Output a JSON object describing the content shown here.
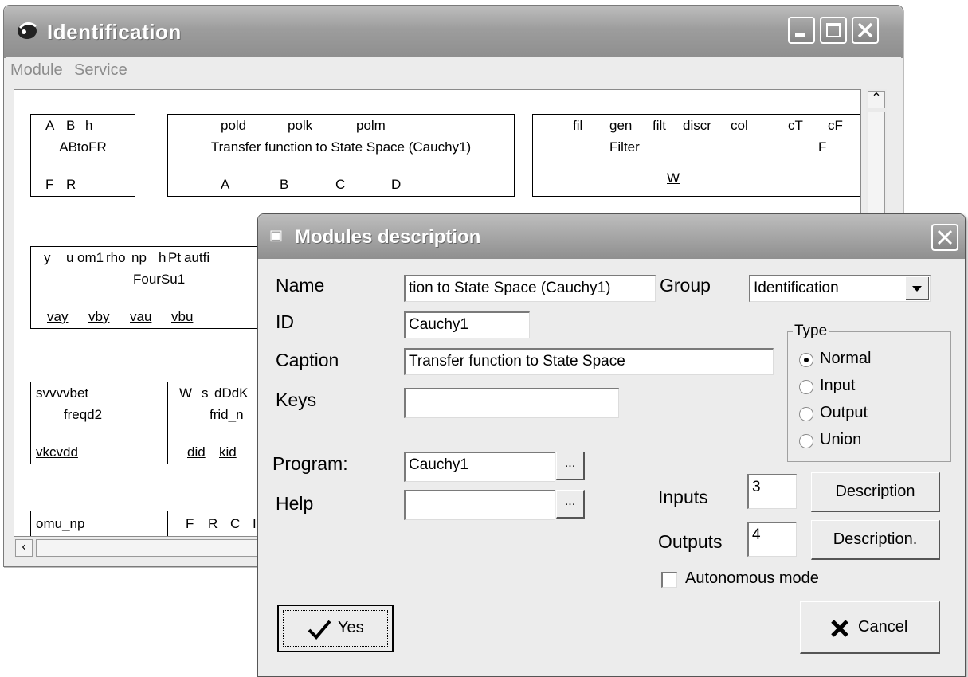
{
  "main_window": {
    "title": "Identification",
    "menu": [
      "Module",
      "Service"
    ]
  },
  "modules": [
    {
      "id": "abtofr",
      "inputs": [
        "A",
        "B",
        "h"
      ],
      "name": "ABtoFR",
      "outputs": [
        "F",
        "R"
      ]
    },
    {
      "id": "tf2ss",
      "inputs": [
        "pold",
        "polk",
        "polm"
      ],
      "name": "Transfer function to State Space  (Cauchy1)",
      "outputs": [
        "A",
        "B",
        "C",
        "D"
      ]
    },
    {
      "id": "filter",
      "inputs": [
        "fil",
        "gen",
        "filt",
        "discr",
        "col",
        "cT",
        "cF"
      ],
      "name": "Filter",
      "name2": "F",
      "outputs": [
        "W"
      ]
    },
    {
      "id": "foursu1",
      "inputs": [
        "y",
        "u",
        "om1",
        "rho",
        "np",
        "h",
        "Pt",
        "autfi"
      ],
      "name": "FourSu1",
      "outputs": [
        "vay",
        "vby",
        "vau",
        "vbu"
      ]
    },
    {
      "id": "freqd2",
      "inputs": [
        "svvvvbet"
      ],
      "name": "freqd2",
      "outputs": [
        "vkcvdd"
      ]
    },
    {
      "id": "frid_n",
      "inputs": [
        "W",
        "s",
        "dDdK"
      ],
      "name": "frid_n",
      "outputs": [
        "did",
        "kid"
      ]
    },
    {
      "id": "omu_np",
      "inputs": [
        "omu_np"
      ],
      "name": "",
      "outputs": []
    },
    {
      "id": "frc",
      "inputs": [
        "F",
        "R",
        "C",
        "I"
      ],
      "name": "",
      "outputs": []
    }
  ],
  "dialog": {
    "title": "Modules description",
    "name_label": "Name",
    "name_value": "tion to State Space  (Cauchy1)",
    "group_label": "Group",
    "group_value": "Identification",
    "id_label": "ID",
    "id_value": "Cauchy1",
    "caption_label": "Caption",
    "caption_value": "Transfer function to State Space",
    "keys_label": "Keys",
    "keys_value": "",
    "program_label": "Program:",
    "program_value": "Cauchy1",
    "help_label": "Help",
    "help_value": "",
    "browse_label": "...",
    "type_label": "Type",
    "type_options": [
      "Normal",
      "Input",
      "Output",
      "Union"
    ],
    "type_selected": "Normal",
    "inputs_label": "Inputs",
    "inputs_value": "3",
    "outputs_label": "Outputs",
    "outputs_value": "4",
    "description_button": "Description",
    "description2_button": "Description.",
    "autonomous_label": "Autonomous mode",
    "autonomous_checked": false,
    "yes_button": "Yes",
    "cancel_button": "Cancel"
  }
}
